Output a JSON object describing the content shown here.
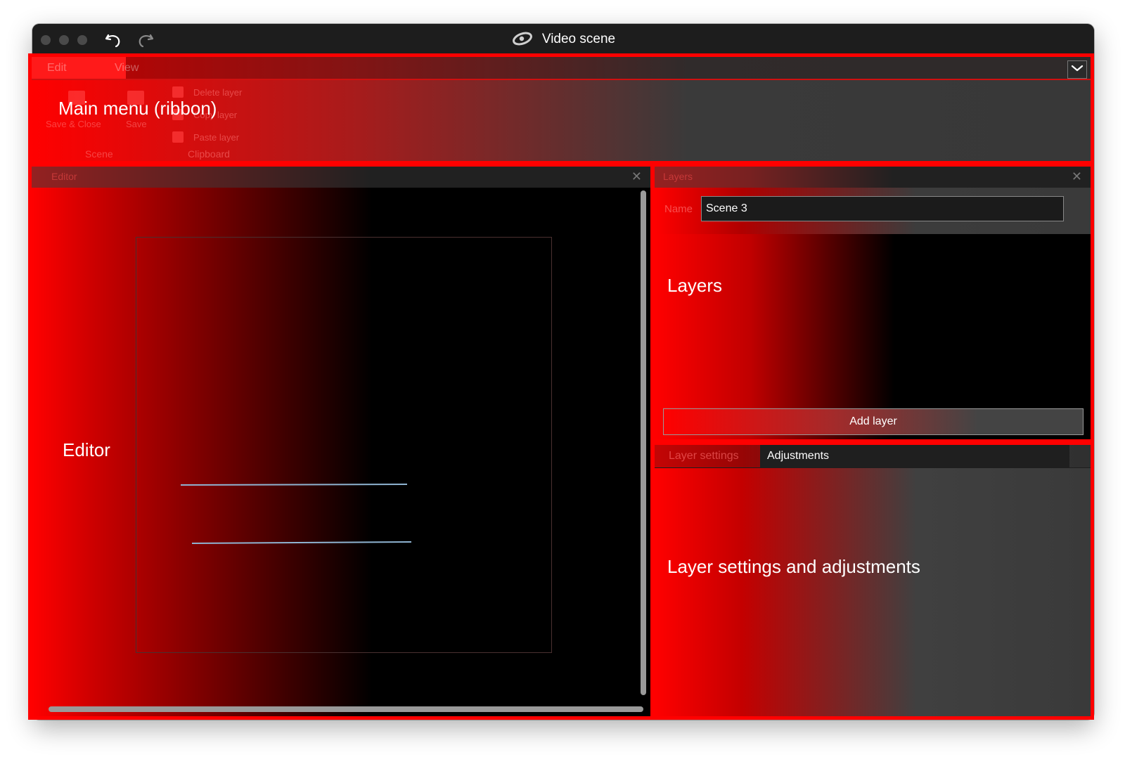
{
  "window": {
    "title": "Video scene",
    "toolbar": {
      "undo_icon": "undo-icon",
      "redo_icon": "redo-icon",
      "app_icon": "app-logo-icon"
    }
  },
  "annotation": {
    "color": "#ff0000"
  },
  "ribbon": {
    "overlay_label": "Main menu (ribbon)",
    "tabs": [
      {
        "label": "Edit",
        "active": true
      },
      {
        "label": "View",
        "active": false
      }
    ],
    "collapse_icon": "chevron-down-icon",
    "groups": [
      {
        "label": "Scene",
        "items": [
          "Save & Close",
          "Save"
        ]
      },
      {
        "label": "Clipboard",
        "items": [
          "Delete layer",
          "Copy layer",
          "Paste layer"
        ]
      }
    ]
  },
  "editor": {
    "panel_title": "Editor",
    "overlay_label": "Editor",
    "close_icon": "close-icon"
  },
  "layers": {
    "panel_title": "Layers",
    "overlay_label": "Layers",
    "name_label": "Name",
    "name_value": "Scene 3",
    "add_button": "Add layer",
    "close_icon": "close-icon"
  },
  "settings": {
    "overlay_label": "Layer settings and adjustments",
    "tabs": [
      "Layer settings",
      "Adjustments"
    ]
  }
}
